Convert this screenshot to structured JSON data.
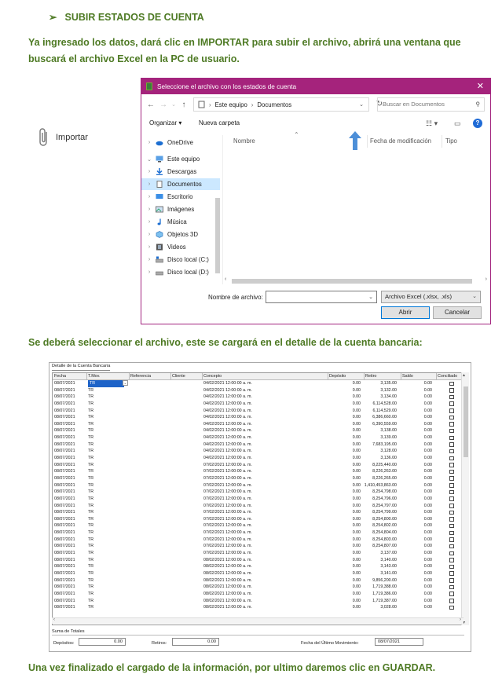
{
  "heading": {
    "bullet": "➢",
    "text": "SUBIR ESTADOS DE CUENTA"
  },
  "paragraphs": {
    "p1": "Ya ingresado los datos, dará clic en IMPORTAR para subir el archivo, abrirá una ventana que buscará el archivo Excel en la PC de usuario.",
    "p2": "Se deberá seleccionar el archivo, este se cargará en el detalle de la cuenta bancaria:",
    "p3": "Una vez finalizado el cargado de la información, por ultimo daremos clic en GUARDAR."
  },
  "import_button": {
    "label": "Importar",
    "icon": "paperclip-icon"
  },
  "dialog": {
    "title": "Seleccione el archivo con los estados de cuenta",
    "path": [
      "Este equipo",
      "Documentos"
    ],
    "search_placeholder": "Buscar en Documentos",
    "organize": "Organizar ▾",
    "new_folder": "Nueva carpeta",
    "nav": [
      {
        "label": "OneDrive",
        "expanded": false
      },
      {
        "label": "Este equipo",
        "expanded": true
      },
      {
        "label": "Descargas",
        "expanded": false
      },
      {
        "label": "Documentos",
        "expanded": false,
        "selected": true
      },
      {
        "label": "Escritorio",
        "expanded": false
      },
      {
        "label": "Imágenes",
        "expanded": false
      },
      {
        "label": "Música",
        "expanded": false
      },
      {
        "label": "Objetos 3D",
        "expanded": false
      },
      {
        "label": "Videos",
        "expanded": false
      },
      {
        "label": "Disco local (C:)",
        "expanded": false
      },
      {
        "label": "Disco local (D:)",
        "expanded": false
      }
    ],
    "columns": {
      "name": "Nombre",
      "modified": "Fecha de modificación",
      "type": "Tipo"
    },
    "filename_label": "Nombre de archivo:",
    "filename_value": "",
    "filetype": "Archivo Excel (.xlsx, .xls)",
    "open_label": "Abrir",
    "cancel_label": "Cancelar",
    "colors": {
      "titlebar": "#a5237c",
      "selected": "#cce8ff"
    }
  },
  "grid": {
    "title": "Detalle de la Cuenta Bancaria",
    "headers": [
      "Fecha",
      "T.Mov.",
      "Referencia",
      "Cliente",
      "Concepto",
      "Depósito",
      "Retiro",
      "Saldo",
      "Conciliado"
    ],
    "rows": [
      [
        "08/07/2021",
        "TR",
        "",
        "",
        "04/02/2021 12:00:00 a. m.",
        "0.00",
        "3,135.00",
        "0.00"
      ],
      [
        "08/07/2021",
        "TR",
        "",
        "",
        "04/02/2021 12:00:00 a. m.",
        "0.00",
        "3,132.00",
        "0.00"
      ],
      [
        "08/07/2021",
        "TR",
        "",
        "",
        "04/02/2021 12:00:00 a. m.",
        "0.00",
        "3,134.00",
        "0.00"
      ],
      [
        "08/07/2021",
        "TR",
        "",
        "",
        "04/02/2021 12:00:00 a. m.",
        "0.00",
        "6,114,528.00",
        "0.00"
      ],
      [
        "08/07/2021",
        "TR",
        "",
        "",
        "04/02/2021 12:00:00 a. m.",
        "0.00",
        "6,114,529.00",
        "0.00"
      ],
      [
        "08/07/2021",
        "TR",
        "",
        "",
        "04/02/2021 12:00:00 a. m.",
        "0.00",
        "6,386,660.00",
        "0.00"
      ],
      [
        "08/07/2021",
        "TR",
        "",
        "",
        "04/02/2021 12:00:00 a. m.",
        "0.00",
        "6,390,559.00",
        "0.00"
      ],
      [
        "08/07/2021",
        "TR",
        "",
        "",
        "04/02/2021 12:00:00 a. m.",
        "0.00",
        "3,138.00",
        "0.00"
      ],
      [
        "08/07/2021",
        "TR",
        "",
        "",
        "04/02/2021 12:00:00 a. m.",
        "0.00",
        "3,139.00",
        "0.00"
      ],
      [
        "08/07/2021",
        "TR",
        "",
        "",
        "04/02/2021 12:00:00 a. m.",
        "0.00",
        "7,683,195.00",
        "0.00"
      ],
      [
        "08/07/2021",
        "TR",
        "",
        "",
        "04/02/2021 12:00:00 a. m.",
        "0.00",
        "3,128.00",
        "0.00"
      ],
      [
        "08/07/2021",
        "TR",
        "",
        "",
        "04/02/2021 12:00:00 a. m.",
        "0.00",
        "3,136.00",
        "0.00"
      ],
      [
        "08/07/2021",
        "TR",
        "",
        "",
        "07/02/2021 12:00:00 a. m.",
        "0.00",
        "8,225,440.00",
        "0.00"
      ],
      [
        "08/07/2021",
        "TR",
        "",
        "",
        "07/02/2021 12:00:00 a. m.",
        "0.00",
        "8,226,263.00",
        "0.00"
      ],
      [
        "08/07/2021",
        "TR",
        "",
        "",
        "07/02/2021 12:00:00 a. m.",
        "0.00",
        "8,226,265.00",
        "0.00"
      ],
      [
        "08/07/2021",
        "TR",
        "",
        "",
        "07/02/2021 12:00:00 a. m.",
        "0.00",
        "1,410,453,863.00",
        "0.00"
      ],
      [
        "08/07/2021",
        "TR",
        "",
        "",
        "07/02/2021 12:00:00 a. m.",
        "0.00",
        "8,254,798.00",
        "0.00"
      ],
      [
        "08/07/2021",
        "TR",
        "",
        "",
        "07/02/2021 12:00:00 a. m.",
        "0.00",
        "8,254,796.00",
        "0.00"
      ],
      [
        "08/07/2021",
        "TR",
        "",
        "",
        "07/02/2021 12:00:00 a. m.",
        "0.00",
        "8,254,797.00",
        "0.00"
      ],
      [
        "08/07/2021",
        "TR",
        "",
        "",
        "07/02/2021 12:00:00 a. m.",
        "0.00",
        "8,254,799.00",
        "0.00"
      ],
      [
        "08/07/2021",
        "TR",
        "",
        "",
        "07/02/2021 12:00:00 a. m.",
        "0.00",
        "8,254,800.00",
        "0.00"
      ],
      [
        "08/07/2021",
        "TR",
        "",
        "",
        "07/02/2021 12:00:00 a. m.",
        "0.00",
        "8,254,802.00",
        "0.00"
      ],
      [
        "08/07/2021",
        "TR",
        "",
        "",
        "07/02/2021 12:00:00 a. m.",
        "0.00",
        "8,254,804.00",
        "0.00"
      ],
      [
        "08/07/2021",
        "TR",
        "",
        "",
        "07/02/2021 12:00:00 a. m.",
        "0.00",
        "8,254,803.00",
        "0.00"
      ],
      [
        "08/07/2021",
        "TR",
        "",
        "",
        "07/02/2021 12:00:00 a. m.",
        "0.00",
        "8,254,807.00",
        "0.00"
      ],
      [
        "08/07/2021",
        "TR",
        "",
        "",
        "07/02/2021 12:00:00 a. m.",
        "0.00",
        "3,137.00",
        "0.00"
      ],
      [
        "08/07/2021",
        "TR",
        "",
        "",
        "08/02/2021 12:00:00 a. m.",
        "0.00",
        "3,140.00",
        "0.00"
      ],
      [
        "08/07/2021",
        "TR",
        "",
        "",
        "08/02/2021 12:00:00 a. m.",
        "0.00",
        "3,143.00",
        "0.00"
      ],
      [
        "08/07/2021",
        "TR",
        "",
        "",
        "08/02/2021 12:00:00 a. m.",
        "0.00",
        "3,141.00",
        "0.00"
      ],
      [
        "08/07/2021",
        "TR",
        "",
        "",
        "08/02/2021 12:00:00 a. m.",
        "0.00",
        "9,856,200.00",
        "0.00"
      ],
      [
        "08/07/2021",
        "TR",
        "",
        "",
        "08/02/2021 12:00:00 a. m.",
        "0.00",
        "1,719,388.00",
        "0.00"
      ],
      [
        "08/07/2021",
        "TR",
        "",
        "",
        "08/02/2021 12:00:00 a. m.",
        "0.00",
        "1,719,386.00",
        "0.00"
      ],
      [
        "08/07/2021",
        "TR",
        "",
        "",
        "08/02/2021 12:00:00 a. m.",
        "0.00",
        "1,719,387.00",
        "0.00"
      ],
      [
        "08/07/2021",
        "TR",
        "",
        "",
        "08/02/2021 12:00:00 a. m.",
        "0.00",
        "3,028.00",
        "0.00"
      ]
    ],
    "totals_label": "Suma de Totales",
    "depositos_label": "Depósitos:",
    "depositos_value": "0.00",
    "retiros_label": "Retiros:",
    "retiros_value": "0.00",
    "last_move_label": "Fecha del Último Movimiento:",
    "last_move_value": "08/07/2021"
  }
}
